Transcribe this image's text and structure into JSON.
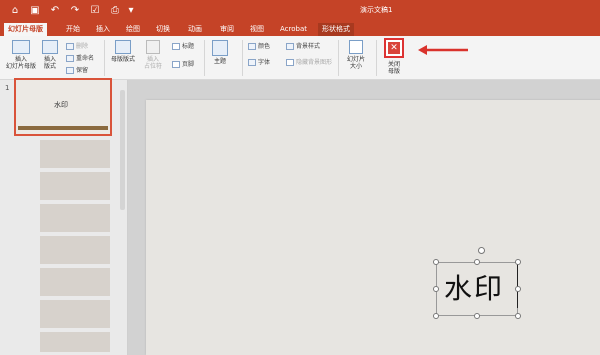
{
  "titlebar": {
    "doc_title": "演示文稿1",
    "quick_access": [
      {
        "icon": "home-icon",
        "glyph": "⌂"
      },
      {
        "icon": "save-icon",
        "glyph": "▣"
      },
      {
        "icon": "undo-icon",
        "glyph": "↶"
      },
      {
        "icon": "redo-icon",
        "glyph": "↷"
      },
      {
        "icon": "checklist-icon",
        "glyph": "☑"
      },
      {
        "icon": "print-icon",
        "glyph": "⎙"
      },
      {
        "icon": "more-icon",
        "glyph": "▾"
      }
    ]
  },
  "tabs": [
    "幻灯片母版",
    "开始",
    "插入",
    "绘图",
    "切换",
    "动画",
    "审阅",
    "视图",
    "Acrobat",
    "形状格式"
  ],
  "ribbon": {
    "insert_master": "插入\n幻灯片母版",
    "insert_layout": "插入\n版式",
    "delete": "删除",
    "rename": "重命名",
    "preserve": "保留",
    "master_layout": "母版版式",
    "insert_placeholder": "插入\n占位符",
    "title": "标题",
    "footer": "页脚",
    "theme": "主题",
    "colors": "颜色",
    "fonts": "字体",
    "background_styles": "背景样式",
    "hide_background": "隐藏背景图形",
    "slide_size": "幻灯片\n大小",
    "close_master": "关闭\n母版"
  },
  "thumbnails": {
    "slide_number": "1",
    "thumb_text": "水印"
  },
  "slide": {
    "watermark_text": "水印"
  },
  "colors": {
    "accent": "#c54327",
    "close_red": "#d9443a",
    "arrow_red": "#d9322c"
  }
}
